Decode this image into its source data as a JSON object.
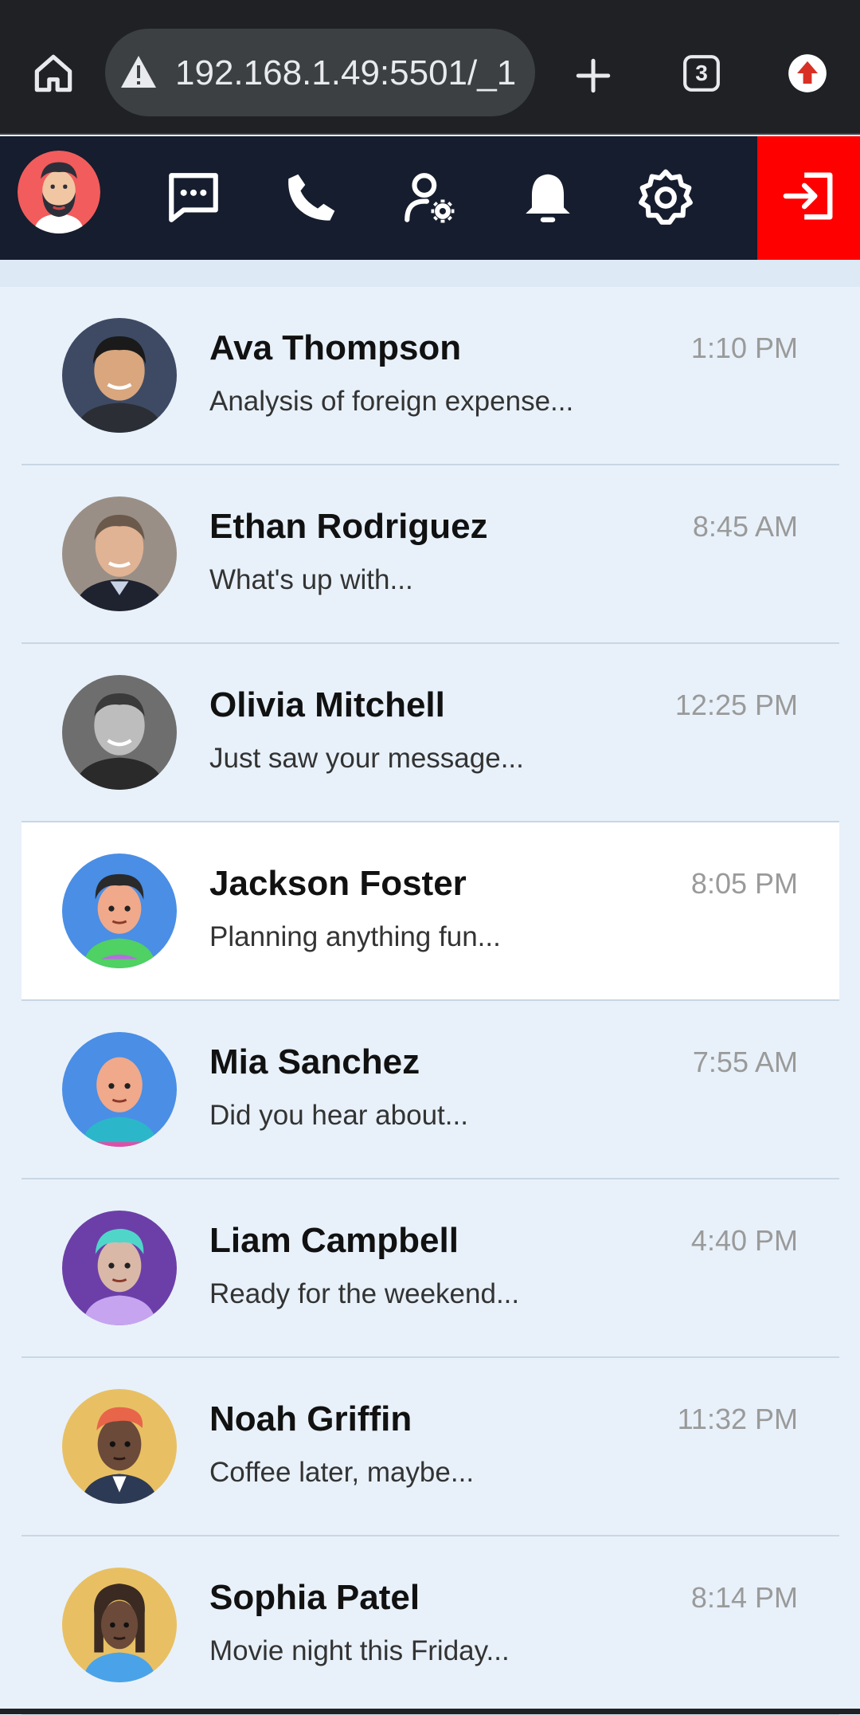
{
  "browser": {
    "url": "192.168.1.49:5501/_1",
    "tab_count": "3"
  },
  "nav": {
    "icons": [
      "chat-icon",
      "phone-icon",
      "user-settings-icon",
      "bell-icon",
      "gear-icon",
      "logout-icon"
    ],
    "colors": {
      "nav_bg": "#161d2e",
      "logout_bg": "#ff0000"
    }
  },
  "chats": [
    {
      "name": "Ava Thompson",
      "time": "1:10 PM",
      "preview": "Analysis of foreign expense..."
    },
    {
      "name": "Ethan Rodriguez",
      "time": "8:45 AM",
      "preview": "What's up with..."
    },
    {
      "name": "Olivia Mitchell",
      "time": "12:25 PM",
      "preview": "Just saw your message..."
    },
    {
      "name": "Jackson Foster",
      "time": "8:05 PM",
      "preview": "Planning anything fun..."
    },
    {
      "name": "Mia Sanchez",
      "time": "7:55 AM",
      "preview": "Did you hear about..."
    },
    {
      "name": "Liam Campbell",
      "time": "4:40 PM",
      "preview": "Ready for the weekend..."
    },
    {
      "name": "Noah Griffin",
      "time": "11:32 PM",
      "preview": "Coffee later, maybe..."
    },
    {
      "name": "Sophia Patel",
      "time": "8:14 PM",
      "preview": "Movie night this Friday..."
    }
  ],
  "selected_chat": "Jackson Foster"
}
